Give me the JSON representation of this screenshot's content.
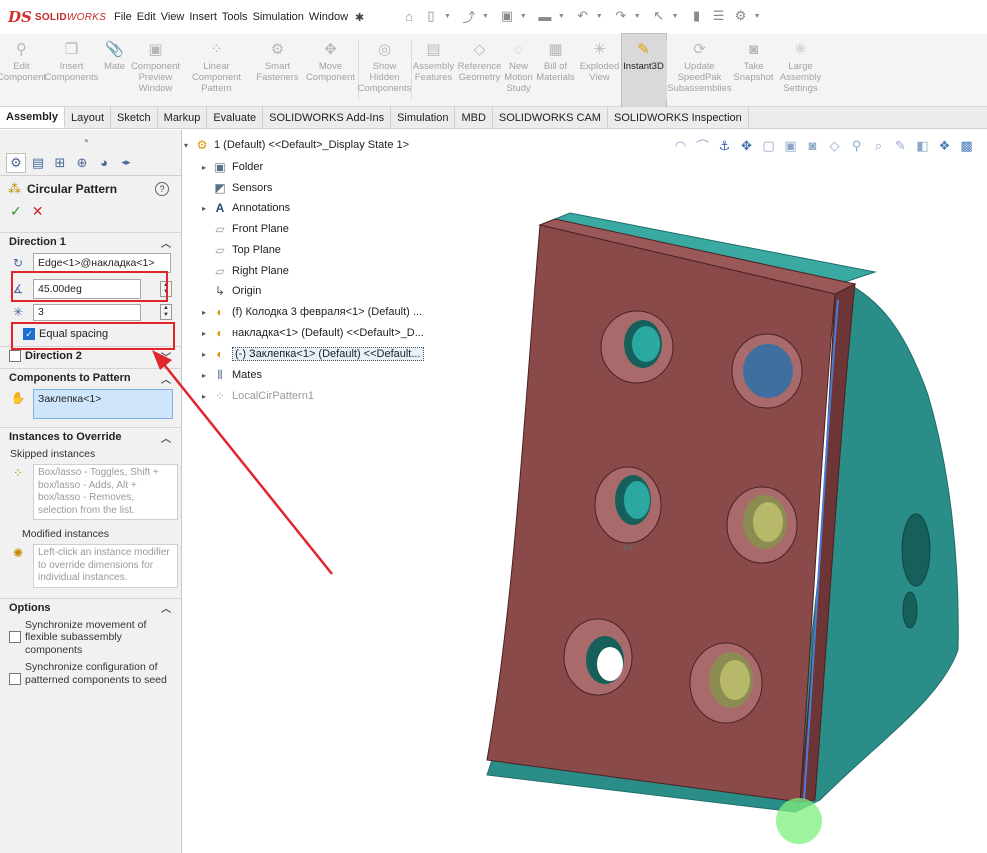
{
  "titlebar": {
    "logo_ds": "DS",
    "logo_solid": "SOLID",
    "logo_works": "WORKS",
    "menus": [
      "File",
      "Edit",
      "View",
      "Insert",
      "Tools",
      "Simulation",
      "Window"
    ],
    "pin": "✱"
  },
  "ribbon": {
    "buttons": [
      {
        "label": "Edit\nComponent",
        "icon": "edit-component-icon",
        "active": false
      },
      {
        "label": "Insert\nComponents",
        "icon": "insert-components-icon",
        "active": false
      },
      {
        "label": "Mate",
        "icon": "mate-icon",
        "active": false
      },
      {
        "label": "Component\nPreview\nWindow",
        "icon": "component-preview-icon",
        "active": false
      },
      {
        "label": "Linear Component\nPattern",
        "icon": "linear-pattern-icon",
        "active": false
      },
      {
        "label": "Smart\nFasteners",
        "icon": "smart-fasteners-icon",
        "active": false
      },
      {
        "label": "Move\nComponent",
        "icon": "move-component-icon",
        "active": false
      },
      {
        "label": "Show\nHidden\nComponents",
        "icon": "show-hidden-icon",
        "active": false
      },
      {
        "label": "Assembly\nFeatures",
        "icon": "assembly-features-icon",
        "active": false
      },
      {
        "label": "Reference\nGeometry",
        "icon": "reference-geometry-icon",
        "active": false
      },
      {
        "label": "New\nMotion\nStudy",
        "icon": "motion-study-icon",
        "active": false
      },
      {
        "label": "Bill of\nMaterials",
        "icon": "bom-icon",
        "active": false
      },
      {
        "label": "Exploded\nView",
        "icon": "exploded-view-icon",
        "active": false
      },
      {
        "label": "Instant3D",
        "icon": "instant3d-icon",
        "active": true
      },
      {
        "label": "Update\nSpeedPak\nSubassemblies",
        "icon": "speedpak-icon",
        "active": false
      },
      {
        "label": "Take\nSnapshot",
        "icon": "snapshot-icon",
        "active": false
      },
      {
        "label": "Large\nAssembly\nSettings",
        "icon": "large-assembly-icon",
        "active": false
      }
    ]
  },
  "tabs": [
    "Assembly",
    "Layout",
    "Sketch",
    "Markup",
    "Evaluate",
    "SOLIDWORKS Add-Ins",
    "Simulation",
    "MBD",
    "SOLIDWORKS CAM",
    "SOLIDWORKS Inspection"
  ],
  "active_tab": "Assembly",
  "pm": {
    "title": "Circular Pattern",
    "help": "?",
    "ok": "✓",
    "cancel": "✕",
    "direction1": {
      "header": "Direction 1",
      "axis": "Edge<1>@накладка<1>",
      "angle": "45.00deg",
      "instances": "3",
      "equal_spacing": "Equal spacing",
      "equal_spacing_checked": true
    },
    "direction2": {
      "header": "Direction 2",
      "checked": false
    },
    "components": {
      "header": "Components to Pattern",
      "item": "Заклепка<1>"
    },
    "instances_override": {
      "header": "Instances to Override",
      "skipped_label": "Skipped instances",
      "skipped_hint": "Box/lasso - Toggles, Shift + box/lasso - Adds, Alt + box/lasso - Removes, selection from the list.",
      "modified_label": "Modified instances",
      "modified_hint": "Left-click an instance modifier to override dimensions for individual instances."
    },
    "options": {
      "header": "Options",
      "sync_movement": "Synchronize movement of flexible subassembly components",
      "sync_config": "Synchronize configuration of patterned components to seed"
    }
  },
  "tree": {
    "root": "1 (Default) <<Default>_Display State 1>",
    "items": [
      {
        "label": "Folder",
        "icon": "folder-icon",
        "expandable": true
      },
      {
        "label": "Sensors",
        "icon": "sensors-icon",
        "expandable": false
      },
      {
        "label": "Annotations",
        "icon": "annotations-icon",
        "expandable": true
      },
      {
        "label": "Front Plane",
        "icon": "plane-icon",
        "expandable": false
      },
      {
        "label": "Top Plane",
        "icon": "plane-icon",
        "expandable": false
      },
      {
        "label": "Right Plane",
        "icon": "plane-icon",
        "expandable": false
      },
      {
        "label": "Origin",
        "icon": "origin-icon",
        "expandable": false
      },
      {
        "label": "(f) Колодка 3 февраля<1> (Default) ...",
        "icon": "part-icon",
        "expandable": true
      },
      {
        "label": "накладка<1> (Default) <<Default>_D...",
        "icon": "part-icon",
        "expandable": true
      },
      {
        "label": "(-) Заклепка<1> (Default) <<Default...",
        "icon": "part-icon",
        "expandable": true,
        "selected": true
      },
      {
        "label": "Mates",
        "icon": "mates-icon",
        "expandable": true
      },
      {
        "label": "LocalCirPattern1",
        "icon": "pattern-icon",
        "expandable": true,
        "dim": true
      }
    ]
  },
  "colors": {
    "accent_red": "#e0262b",
    "brake_pad": "#8b4a4a",
    "teal": "#2a8a86",
    "selection_blue": "#1c6fd1"
  }
}
